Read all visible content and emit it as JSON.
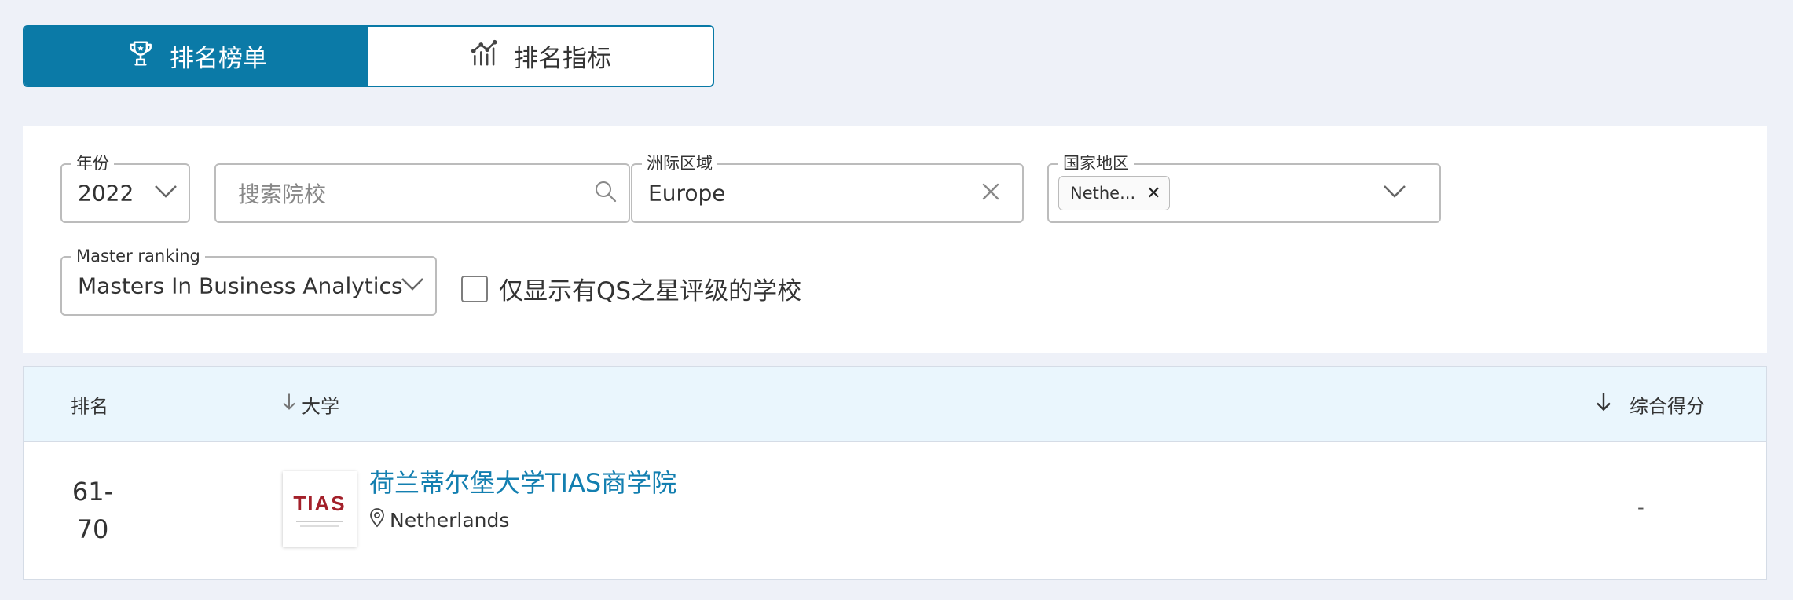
{
  "tabs": [
    {
      "label": "排名榜单",
      "icon": "trophy-icon",
      "active": true
    },
    {
      "label": "排名指标",
      "icon": "chart-icon",
      "active": false
    }
  ],
  "filters": {
    "year": {
      "legend": "年份",
      "value": "2022"
    },
    "search": {
      "placeholder": "搜索院校"
    },
    "region": {
      "legend": "洲际区域",
      "value": "Europe"
    },
    "country": {
      "legend": "国家地区",
      "chip": "Nethe..."
    },
    "master_ranking": {
      "legend": "Master ranking",
      "value": "Masters In Business Analytics"
    },
    "qs_stars_only": {
      "label": "仅显示有QS之星评级的学校",
      "checked": false
    }
  },
  "table": {
    "headers": {
      "rank": "排名",
      "university": "大学",
      "score": "综合得分"
    },
    "rows": [
      {
        "rank_line1": "61-",
        "rank_line2": "70",
        "logo_text": "TIAS",
        "name": "荷兰蒂尔堡大学TIAS商学院",
        "location": "Netherlands",
        "score": "-"
      }
    ]
  },
  "colors": {
    "accent": "#0b7aa7",
    "link": "#137fb0",
    "header_bg": "#eaf6fd",
    "page_bg": "#eef1f8"
  }
}
